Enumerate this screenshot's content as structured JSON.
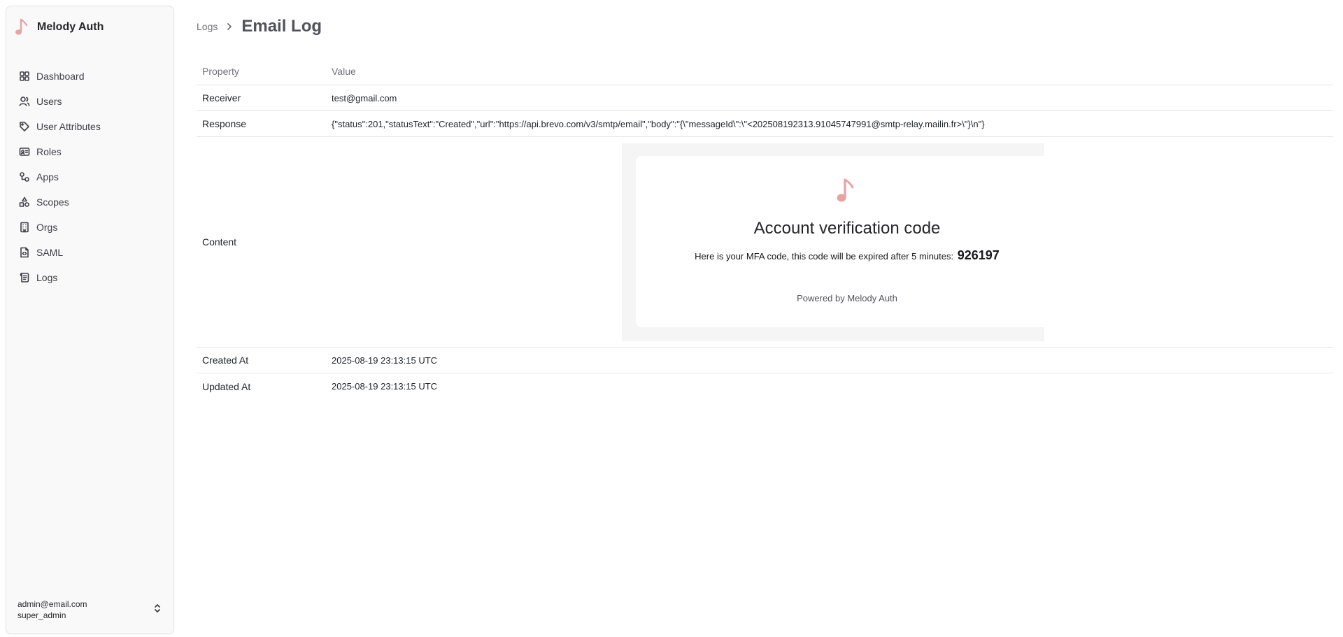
{
  "sidebar": {
    "brand": "Melody Auth",
    "items": [
      {
        "label": "Dashboard",
        "icon": "dashboard-icon"
      },
      {
        "label": "Users",
        "icon": "users-icon"
      },
      {
        "label": "User Attributes",
        "icon": "tag-icon"
      },
      {
        "label": "Roles",
        "icon": "id-card-icon"
      },
      {
        "label": "Apps",
        "icon": "apps-icon"
      },
      {
        "label": "Scopes",
        "icon": "shapes-icon"
      },
      {
        "label": "Orgs",
        "icon": "building-icon"
      },
      {
        "label": "SAML",
        "icon": "file-code-icon"
      },
      {
        "label": "Logs",
        "icon": "scroll-icon"
      }
    ],
    "user": {
      "email": "admin@email.com",
      "role": "super_admin"
    }
  },
  "breadcrumb": {
    "parent": "Logs",
    "title": "Email Log"
  },
  "table": {
    "headers": {
      "property": "Property",
      "value": "Value"
    },
    "receiver": {
      "label": "Receiver",
      "value": "test@gmail.com"
    },
    "response": {
      "label": "Response",
      "value": "{\"status\":201,\"statusText\":\"Created\",\"url\":\"https://api.brevo.com/v3/smtp/email\",\"body\":\"{\\\"messageId\\\":\\\"<202508192313.91045747991@smtp-relay.mailin.fr>\\\"}\\n\"}"
    },
    "content": {
      "label": "Content"
    },
    "created_at": {
      "label": "Created At",
      "value": "2025-08-19 23:13:15 UTC"
    },
    "updated_at": {
      "label": "Updated At",
      "value": "2025-08-19 23:13:15 UTC"
    }
  },
  "email": {
    "title": "Account verification code",
    "text": "Here is your MFA code, this code will be expired after 5 minutes:",
    "code": "926197",
    "powered": "Powered by Melody Auth"
  },
  "colors": {
    "accent": "#e8a3a3"
  }
}
